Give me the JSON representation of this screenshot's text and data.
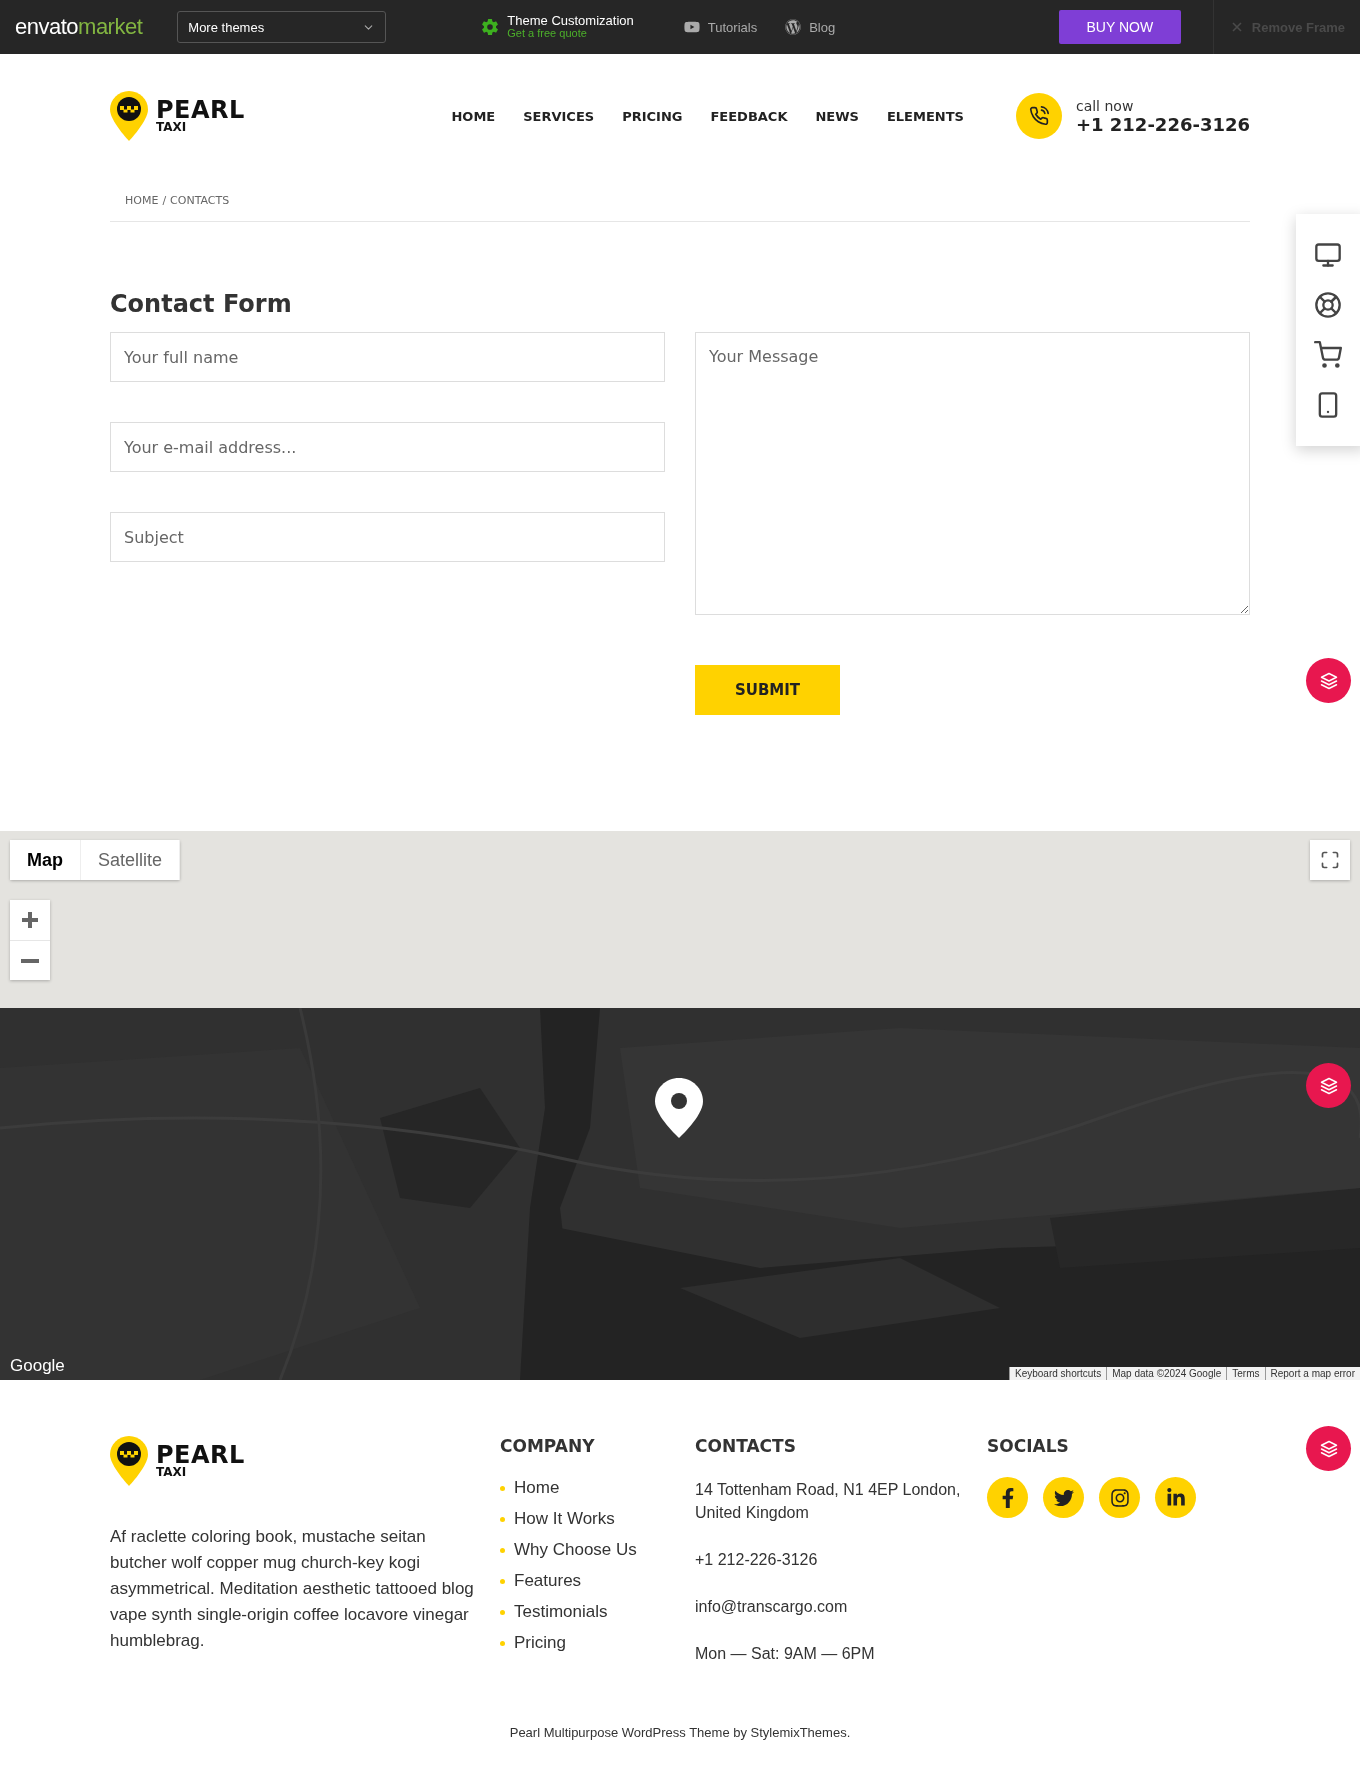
{
  "topbar": {
    "logo_main": "envato",
    "logo_accent": "market",
    "dropdown": "More themes",
    "promo_title": "Theme Customization",
    "promo_subtitle": "Get a free quote",
    "links": [
      {
        "kind": "video",
        "label": "Tutorials"
      },
      {
        "kind": "wordpress",
        "label": "Blog"
      }
    ],
    "buy": "BUY NOW",
    "remove": "Remove Frame"
  },
  "header": {
    "logo_name": "PEARL",
    "logo_tagline": "TAXI",
    "nav": [
      "HOME",
      "SERVICES",
      "PRICING",
      "FEEDBACK",
      "NEWS",
      "ELEMENTS"
    ],
    "call_label": "call now",
    "phone": "+1 212-226-3126"
  },
  "breadcrumb": {
    "items": [
      "HOME",
      "CONTACTS"
    ],
    "separator": "/"
  },
  "form": {
    "title": "Contact Form",
    "fields": [
      {
        "placeholder": "Your full name"
      },
      {
        "placeholder": "Your e-mail address..."
      },
      {
        "placeholder": "Subject"
      }
    ],
    "message_placeholder": "Your Message",
    "submit": "SUBMIT"
  },
  "side_panel": [
    {
      "kind": "desktop"
    },
    {
      "kind": "support"
    },
    {
      "kind": "cart"
    },
    {
      "kind": "phone"
    }
  ],
  "map": {
    "types": [
      {
        "label": "Map",
        "selected": true
      },
      {
        "label": "Satellite",
        "selected": false
      }
    ],
    "logo": "Google",
    "attribution": [
      "Keyboard shortcuts",
      "Map data ©2024 Google",
      "Terms",
      "Report a map error"
    ]
  },
  "footer": {
    "logo_name": "PEARL",
    "logo_tagline": "TAXI",
    "description": "Af raclette coloring book, mustache seitan butcher wolf copper mug church-key kogi asymmetrical. Meditation aesthetic tattooed blog vape synth single-origin coffee locavore vinegar humblebrag.",
    "company": {
      "title": "COMPANY",
      "links": [
        "Home",
        "How It Works",
        "Why Choose Us",
        "Features",
        "Testimonials",
        "Pricing"
      ]
    },
    "contacts": {
      "title": "CONTACTS",
      "lines": [
        "14 Tottenham Road, N1 4EP London, United Kingdom",
        "+1 212-226-3126",
        "info@transcargo.com",
        "Mon — Sat: 9AM — 6PM"
      ]
    },
    "socials": {
      "title": "SOCIALS",
      "items": [
        {
          "kind": "facebook"
        },
        {
          "kind": "twitter"
        },
        {
          "kind": "instagram"
        },
        {
          "kind": "linkedin"
        }
      ]
    },
    "copyright": "Pearl Multipurpose WordPress Theme by StylemixThemes."
  }
}
